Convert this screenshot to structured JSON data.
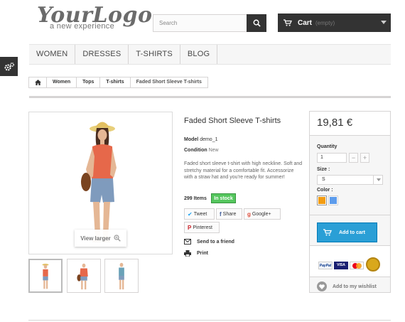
{
  "header": {
    "logo_main": "YourLogo",
    "logo_tagline": "a new experience",
    "search_placeholder": "Search",
    "cart_label": "Cart",
    "cart_status": "(empty)"
  },
  "menu": {
    "items": [
      "Women",
      "Dresses",
      "T-shirts",
      "Blog"
    ]
  },
  "breadcrumb": {
    "items": [
      "Women",
      "Tops",
      "T-shirts",
      "Faded Short Sleeve T-shirts"
    ]
  },
  "product": {
    "title": "Faded Short Sleeve T-shirts",
    "model_label": "Model",
    "model_value": "demo_1",
    "condition_label": "Condition",
    "condition_value": "New",
    "description": "Faded short sleeve t-shirt with high neckline. Soft and stretchy material for a comfortable fit. Accessorize with a straw hat and you're ready for summer!",
    "quantity_text": "299 Items",
    "stock_badge": "In stock",
    "view_larger": "View larger",
    "social": {
      "tweet": "Tweet",
      "share": "Share",
      "google": "Google+",
      "pinterest": "Pinterest"
    },
    "send_to_friend": "Send to a friend",
    "print": "Print"
  },
  "buy_box": {
    "price": "19,81 €",
    "quantity_label": "Quantity",
    "quantity_value": "1",
    "size_label": "Size :",
    "size_value": "S",
    "color_label": "Color :",
    "colors": [
      "#f39c11",
      "#5d9cec"
    ],
    "add_to_cart": "Add to cart",
    "wishlist": "Add to my wishlist",
    "payment_logos": [
      "PayPal",
      "VISA",
      "MasterCard"
    ]
  },
  "colors": {
    "dark": "#333333",
    "accent_blue": "#2a9fd6",
    "stock_green": "#55c65e"
  }
}
